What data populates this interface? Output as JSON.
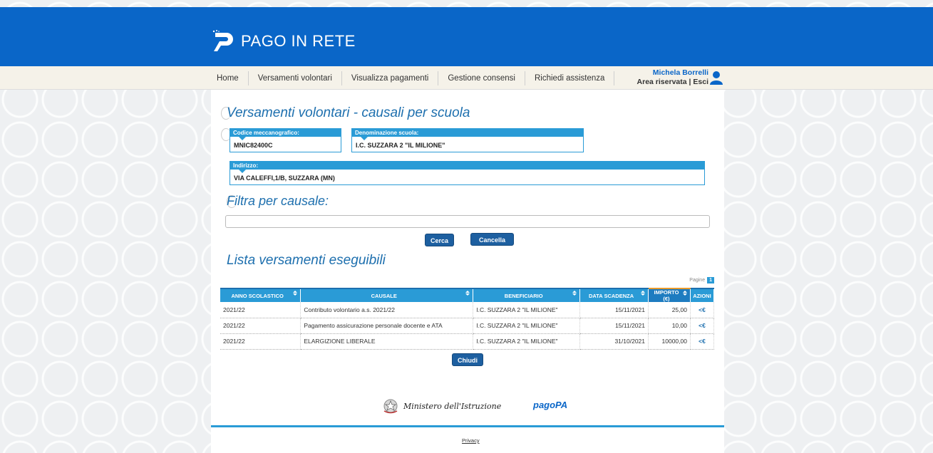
{
  "header": {
    "app_name": "PAGO IN RETE"
  },
  "nav": {
    "items": [
      {
        "label": "Home"
      },
      {
        "label": "Versamenti volontari"
      },
      {
        "label": "Visualizza pagamenti"
      },
      {
        "label": "Gestione consensi"
      },
      {
        "label": "Richiedi assistenza"
      }
    ]
  },
  "user": {
    "name": "Michela Borrelli",
    "area_label": "Area riservata",
    "separator": "|",
    "logout_label": "Esci"
  },
  "page": {
    "title": "Versamenti volontari - causali per scuola",
    "filter_title": "Filtra per causale:",
    "list_title": "Lista versamenti eseguibili"
  },
  "school": {
    "code_label": "Codice meccanografico:",
    "code_value": "MNIC82400C",
    "name_label": "Denominazione scuola:",
    "name_value": "I.C. SUZZARA 2 \"IL MILIONE\"",
    "address_label": "Indirizzo:",
    "address_value": "VIA CALEFFI,1/B, SUZZARA (MN)"
  },
  "filter": {
    "value": "",
    "search_label": "Cerca",
    "clear_label": "Cancella"
  },
  "pagination": {
    "label": "Pagine",
    "current": "1"
  },
  "table": {
    "columns": [
      "ANNO SCOLASTICO",
      "CAUSALE",
      "BENEFICIARIO",
      "DATA SCADENZA",
      "IMPORTO (€)",
      "AZIONI"
    ],
    "rows": [
      {
        "anno": "2021/22",
        "causale": "Contributo volontario a.s. 2021/22",
        "beneficiario": "I.C. SUZZARA 2 \"IL MILIONE\"",
        "scadenza": "15/11/2021",
        "importo": "25,00",
        "azione": "<€"
      },
      {
        "anno": "2021/22",
        "causale": "Pagamento assicurazione personale docente e ATA",
        "beneficiario": "I.C. SUZZARA 2 \"IL MILIONE\"",
        "scadenza": "15/11/2021",
        "importo": "10,00",
        "azione": "<€"
      },
      {
        "anno": "2021/22",
        "causale": "ELARGIZIONE LIBERALE",
        "beneficiario": "I.C. SUZZARA 2 \"IL MILIONE\"",
        "scadenza": "31/10/2021",
        "importo": "10000,00",
        "azione": "<€"
      }
    ]
  },
  "actions": {
    "close_label": "Chiudi"
  },
  "footer": {
    "ministry": "Ministero dell'Istruzione",
    "pagopa": "pagoPA",
    "privacy": "Privacy"
  },
  "colors": {
    "brand_blue": "#0a66c8",
    "accent_blue": "#2a9bd6",
    "button_blue": "#1d5fa0"
  }
}
